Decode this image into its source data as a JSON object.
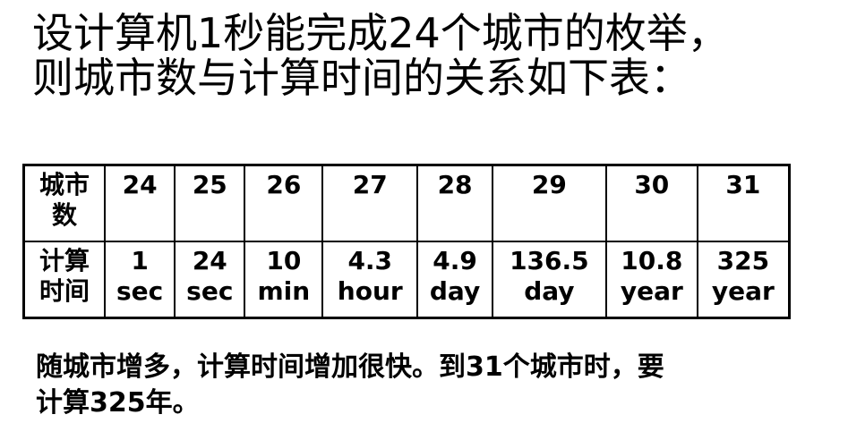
{
  "heading": {
    "line1": "设计算机1秒能完成24个城市的枚举，",
    "line2": "则城市数与计算时间的关系如下表："
  },
  "table": {
    "row1_header": [
      "城市",
      "数"
    ],
    "row2_header": [
      "计算",
      "时间"
    ],
    "city_counts": [
      "24",
      "25",
      "26",
      "27",
      "28",
      "29",
      "30",
      "31"
    ],
    "times": [
      [
        "1",
        "sec"
      ],
      [
        "24",
        "sec"
      ],
      [
        "10",
        "min"
      ],
      [
        "4.3",
        "hour"
      ],
      [
        "4.9",
        "day"
      ],
      [
        "136.5",
        "day"
      ],
      [
        "10.8",
        "year"
      ],
      [
        "325",
        "year"
      ]
    ]
  },
  "note": {
    "line1": "随城市增多，计算时间增加很快。到31个城市时，要",
    "line2": "计算325年。"
  }
}
